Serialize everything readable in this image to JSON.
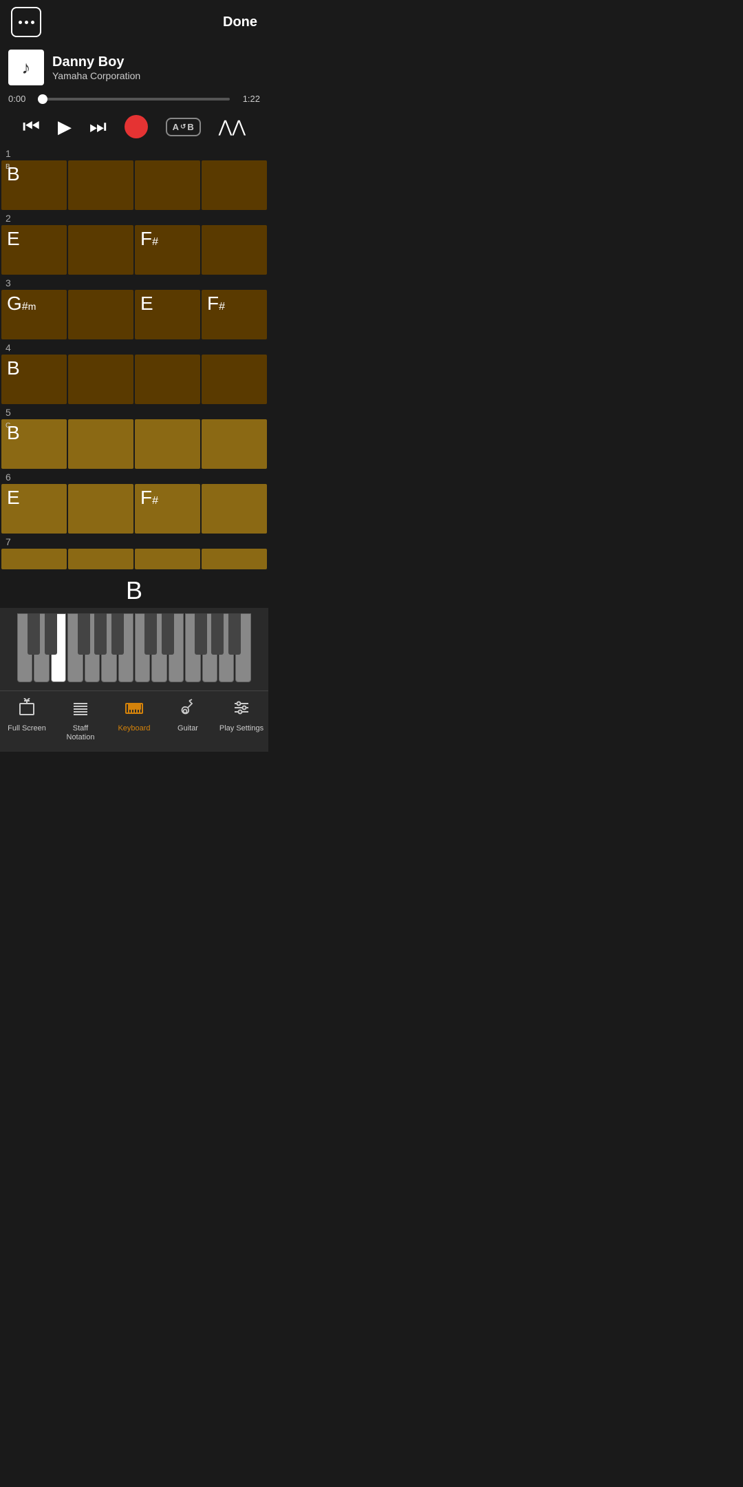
{
  "header": {
    "dots_label": "···",
    "done_label": "Done"
  },
  "song": {
    "title": "Danny Boy",
    "artist": "Yamaha Corporation",
    "time_current": "0:00",
    "time_total": "1:22",
    "progress_percent": 2
  },
  "transport": {
    "rewind": "⏮",
    "play": "▶",
    "ff": "⏭",
    "ab_label": "A↺B",
    "priority_label": "⋀⋀"
  },
  "chord_rows": [
    {
      "row_num": "1",
      "active": false,
      "section_marker": "B",
      "cells": [
        {
          "chord": "B",
          "modifier": "",
          "sub": ""
        },
        {
          "chord": "",
          "modifier": "",
          "sub": ""
        },
        {
          "chord": "",
          "modifier": "",
          "sub": ""
        },
        {
          "chord": "",
          "modifier": "",
          "sub": ""
        }
      ]
    },
    {
      "row_num": "2",
      "active": false,
      "section_marker": "",
      "cells": [
        {
          "chord": "E",
          "modifier": "",
          "sub": ""
        },
        {
          "chord": "",
          "modifier": "",
          "sub": ""
        },
        {
          "chord": "F",
          "modifier": "#",
          "sub": ""
        },
        {
          "chord": "",
          "modifier": "",
          "sub": ""
        }
      ]
    },
    {
      "row_num": "3",
      "active": false,
      "section_marker": "",
      "cells": [
        {
          "chord": "G",
          "modifier": "#",
          "sub": "m"
        },
        {
          "chord": "",
          "modifier": "",
          "sub": ""
        },
        {
          "chord": "E",
          "modifier": "",
          "sub": ""
        },
        {
          "chord": "F",
          "modifier": "#",
          "sub": ""
        }
      ]
    },
    {
      "row_num": "4",
      "active": false,
      "section_marker": "",
      "cells": [
        {
          "chord": "B",
          "modifier": "",
          "sub": ""
        },
        {
          "chord": "",
          "modifier": "",
          "sub": ""
        },
        {
          "chord": "",
          "modifier": "",
          "sub": ""
        },
        {
          "chord": "",
          "modifier": "",
          "sub": ""
        }
      ]
    },
    {
      "row_num": "5",
      "active": true,
      "section_marker": "C",
      "cells": [
        {
          "chord": "B",
          "modifier": "",
          "sub": ""
        },
        {
          "chord": "",
          "modifier": "",
          "sub": ""
        },
        {
          "chord": "",
          "modifier": "",
          "sub": ""
        },
        {
          "chord": "",
          "modifier": "",
          "sub": ""
        }
      ]
    },
    {
      "row_num": "6",
      "active": true,
      "section_marker": "",
      "cells": [
        {
          "chord": "E",
          "modifier": "",
          "sub": ""
        },
        {
          "chord": "",
          "modifier": "",
          "sub": ""
        },
        {
          "chord": "F",
          "modifier": "#",
          "sub": ""
        },
        {
          "chord": "",
          "modifier": "",
          "sub": ""
        }
      ]
    },
    {
      "row_num": "7",
      "active": true,
      "section_marker": "",
      "cells": [
        {
          "chord": "",
          "modifier": "",
          "sub": ""
        },
        {
          "chord": "",
          "modifier": "",
          "sub": ""
        },
        {
          "chord": "",
          "modifier": "",
          "sub": ""
        },
        {
          "chord": "",
          "modifier": "",
          "sub": ""
        }
      ]
    }
  ],
  "current_note": "B",
  "piano": {
    "lit_keys": [
      2
    ]
  },
  "bottom_nav": [
    {
      "id": "fullscreen",
      "label": "Full Screen",
      "active": false
    },
    {
      "id": "staff",
      "label": "Staff\nNotation",
      "active": false
    },
    {
      "id": "keyboard",
      "label": "Keyboard",
      "active": true
    },
    {
      "id": "guitar",
      "label": "Guitar",
      "active": false
    },
    {
      "id": "settings",
      "label": "Play Settings",
      "active": false
    }
  ]
}
